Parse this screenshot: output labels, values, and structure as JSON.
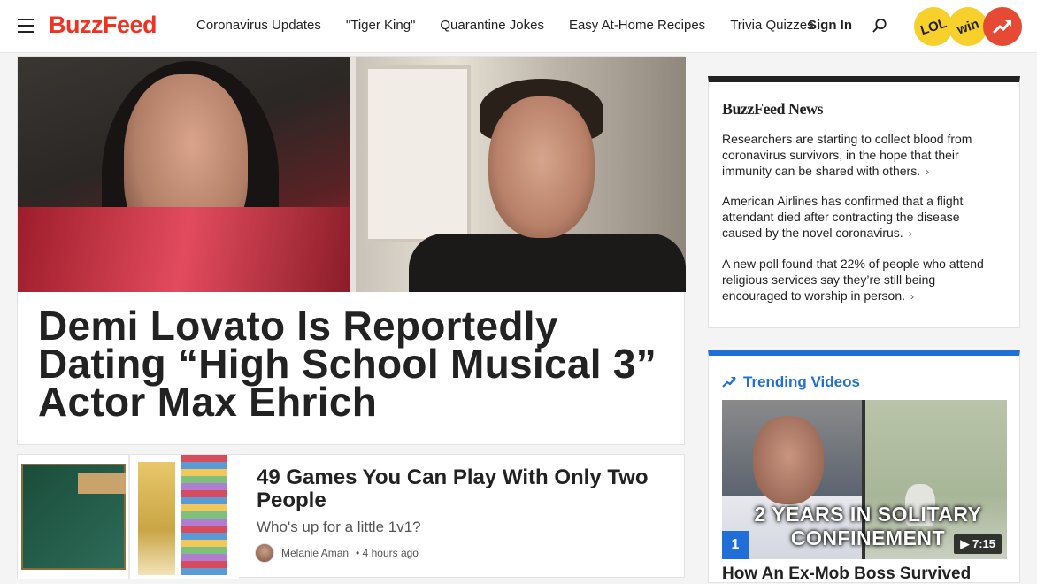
{
  "header": {
    "logo": "BuzzFeed",
    "nav": [
      "Coronavirus Updates",
      "\"Tiger King\"",
      "Quarantine Jokes",
      "Easy At-Home Recipes",
      "Trivia Quizzes"
    ],
    "sign_in": "Sign In",
    "badges": {
      "lol": "LOL",
      "win": "win"
    }
  },
  "hero": {
    "title": "Demi Lovato Is Reportedly Dating “High School Musical 3” Actor Max Ehrich"
  },
  "secondary": {
    "title": "49 Games You Can Play With Only Two People",
    "subtitle": "Who's up for a little 1v1?",
    "author": "Melanie Aman",
    "time": "• 4 hours ago"
  },
  "news": {
    "logo": "BuzzFeed News",
    "items": [
      "Researchers are starting to collect blood from coronavirus survivors, in the hope that their immunity can be shared with others.",
      "American Airlines has confirmed that a flight attendant died after contracting the disease caused by the novel coronavirus.",
      "A new poll found that 22% of people who attend religious services say they’re still being encouraged to worship in person."
    ],
    "chevron": "›"
  },
  "trending": {
    "heading": "Trending Videos",
    "video": {
      "rank": "1",
      "caption": "2 YEARS IN SOLITARY CONFINEMENT",
      "duration": "7:15",
      "title": "How An Ex-Mob Boss Survived"
    }
  },
  "colors": {
    "brand_red": "#e32",
    "news_black": "#222",
    "trending_blue": "#1f6fd6",
    "badge_yellow": "#f8d02c"
  }
}
